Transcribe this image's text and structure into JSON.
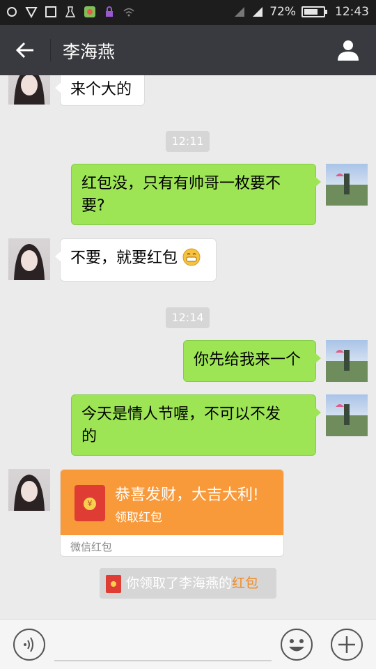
{
  "status_bar": {
    "battery": "72%",
    "battery_level": 0.72,
    "time": "12:43",
    "icons": [
      "sync-icon",
      "shield-icon",
      "screenshot-icon",
      "cleaner-icon",
      "app-icon",
      "lock-icon",
      "wifi-icon",
      "signal-icon",
      "signal-4g-icon",
      "battery-icon"
    ]
  },
  "header": {
    "title": "李海燕",
    "back_icon": "arrow-left-icon",
    "profile_icon": "person-icon"
  },
  "messages": [
    {
      "type": "in",
      "text": "来个大的"
    },
    {
      "type": "time",
      "text": "12:11"
    },
    {
      "type": "out",
      "lines": [
        "红包没，只有有帅哥一枚要不",
        "要?"
      ]
    },
    {
      "type": "in",
      "text": "不要，就要红包",
      "emoji": "grin-emoji"
    },
    {
      "type": "time",
      "text": "12:14"
    },
    {
      "type": "out",
      "text": "你先给我来一个"
    },
    {
      "type": "out",
      "lines": [
        "今天是情人节喔，不可以不发",
        "的"
      ]
    },
    {
      "type": "redpacket",
      "title": "恭喜发财，大吉大利!",
      "subtitle": "领取红包",
      "footer": "微信红包",
      "coin": "¥"
    },
    {
      "type": "notice",
      "prefix": "你领取了李海燕的",
      "highlight": "红包"
    }
  ],
  "colors": {
    "titlebar": "#393a3f",
    "outgoing_bubble": "#9ee555",
    "redpacket": "#f8993a",
    "highlight": "#f08a25"
  }
}
